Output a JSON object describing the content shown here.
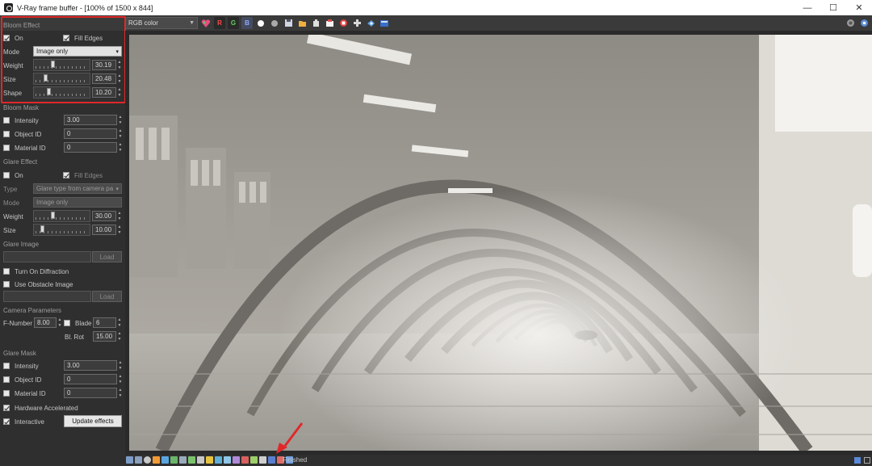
{
  "window": {
    "title": "V-Ray frame buffer - [100% of 1500 x 844]",
    "minimize": "—",
    "maximize": "☐",
    "close": "✕"
  },
  "toolbar": {
    "channel": "RGB color",
    "r_label": "R",
    "g_label": "G",
    "b_label": "B"
  },
  "bloom_effect": {
    "section": "Bloom Effect",
    "on_label": "On",
    "on_checked": true,
    "fill_edges_label": "Fill Edges",
    "fill_edges_checked": true,
    "mode_label": "Mode",
    "mode_value": "Image only",
    "weight_label": "Weight",
    "weight_value": "30.19",
    "size_label": "Size",
    "size_value": "20.48",
    "shape_label": "Shape",
    "shape_value": "10.20"
  },
  "bloom_mask": {
    "section": "Bloom Mask",
    "intensity_label": "Intensity",
    "intensity_value": "3.00",
    "object_id_label": "Object ID",
    "object_id_value": "0",
    "material_id_label": "Material ID",
    "material_id_value": "0"
  },
  "glare_effect": {
    "section": "Glare Effect",
    "on_label": "On",
    "fill_edges_label": "Fill Edges",
    "fill_edges_checked": true,
    "type_label": "Type",
    "type_value": "Glare type from camera pa",
    "mode_label": "Mode",
    "mode_value": "Image only",
    "weight_label": "Weight",
    "weight_value": "30.00",
    "size_label": "Size",
    "size_value": "10.00"
  },
  "glare_image": {
    "section": "Glare Image",
    "load_label": "Load",
    "diffraction_label": "Turn On Diffraction",
    "obstacle_label": "Use Obstacle Image",
    "load2_label": "Load"
  },
  "camera_parameters": {
    "section": "Camera Parameters",
    "fnumber_label": "F-Number",
    "fnumber_value": "8.00",
    "blade_label": "Blade",
    "blade_value": "6",
    "blrot_label": "Bl. Rot",
    "blrot_value": "15.00"
  },
  "glare_mask": {
    "section": "Glare Mask",
    "intensity_label": "Intensity",
    "intensity_value": "3.00",
    "object_id_label": "Object ID",
    "object_id_value": "0",
    "material_id_label": "Material ID",
    "material_id_value": "0"
  },
  "options": {
    "hardware_label": "Hardware Accelerated",
    "interactive_label": "Interactive",
    "update_label": "Update effects"
  },
  "status": {
    "text": "Finished"
  },
  "colors": {
    "highlight": "#e0282a",
    "arrow": "#e0282a",
    "panel_bg": "#2f2f2f"
  }
}
